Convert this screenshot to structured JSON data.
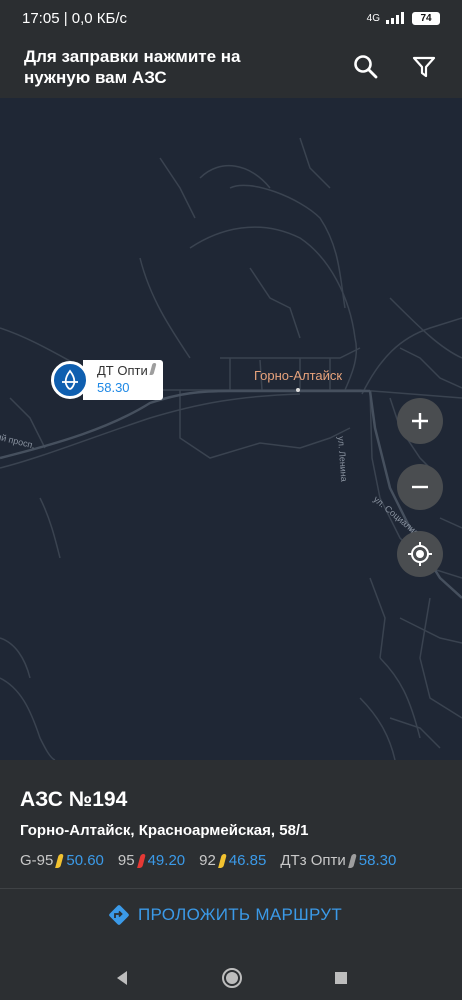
{
  "status_bar": {
    "time_speed": "17:05 | 0,0 КБ/с",
    "network": "4G",
    "battery": "74"
  },
  "header": {
    "title": "Для заправки нажмите на нужную вам АЗС"
  },
  "map": {
    "pin": {
      "name": "ДТ Опти",
      "price": "58.30"
    },
    "city_label": "Горно-Алтайск",
    "streets": [
      "ий просп.",
      "ул. Ленина",
      "ул. Социалис"
    ]
  },
  "station": {
    "title": "АЗС №194",
    "address": "Горно-Алтайск, Красноармейская, 58/1",
    "fuels": [
      {
        "name": "G-95",
        "price": "50.60",
        "color": "#f2c230"
      },
      {
        "name": "95",
        "price": "49.20",
        "color": "#e53935"
      },
      {
        "name": "92",
        "price": "46.85",
        "color": "#f2c230"
      },
      {
        "name": "ДТз Опти",
        "price": "58.30",
        "color": "#9e9e9e"
      }
    ],
    "route_label": "ПРОЛОЖИТЬ МАРШРУТ"
  }
}
